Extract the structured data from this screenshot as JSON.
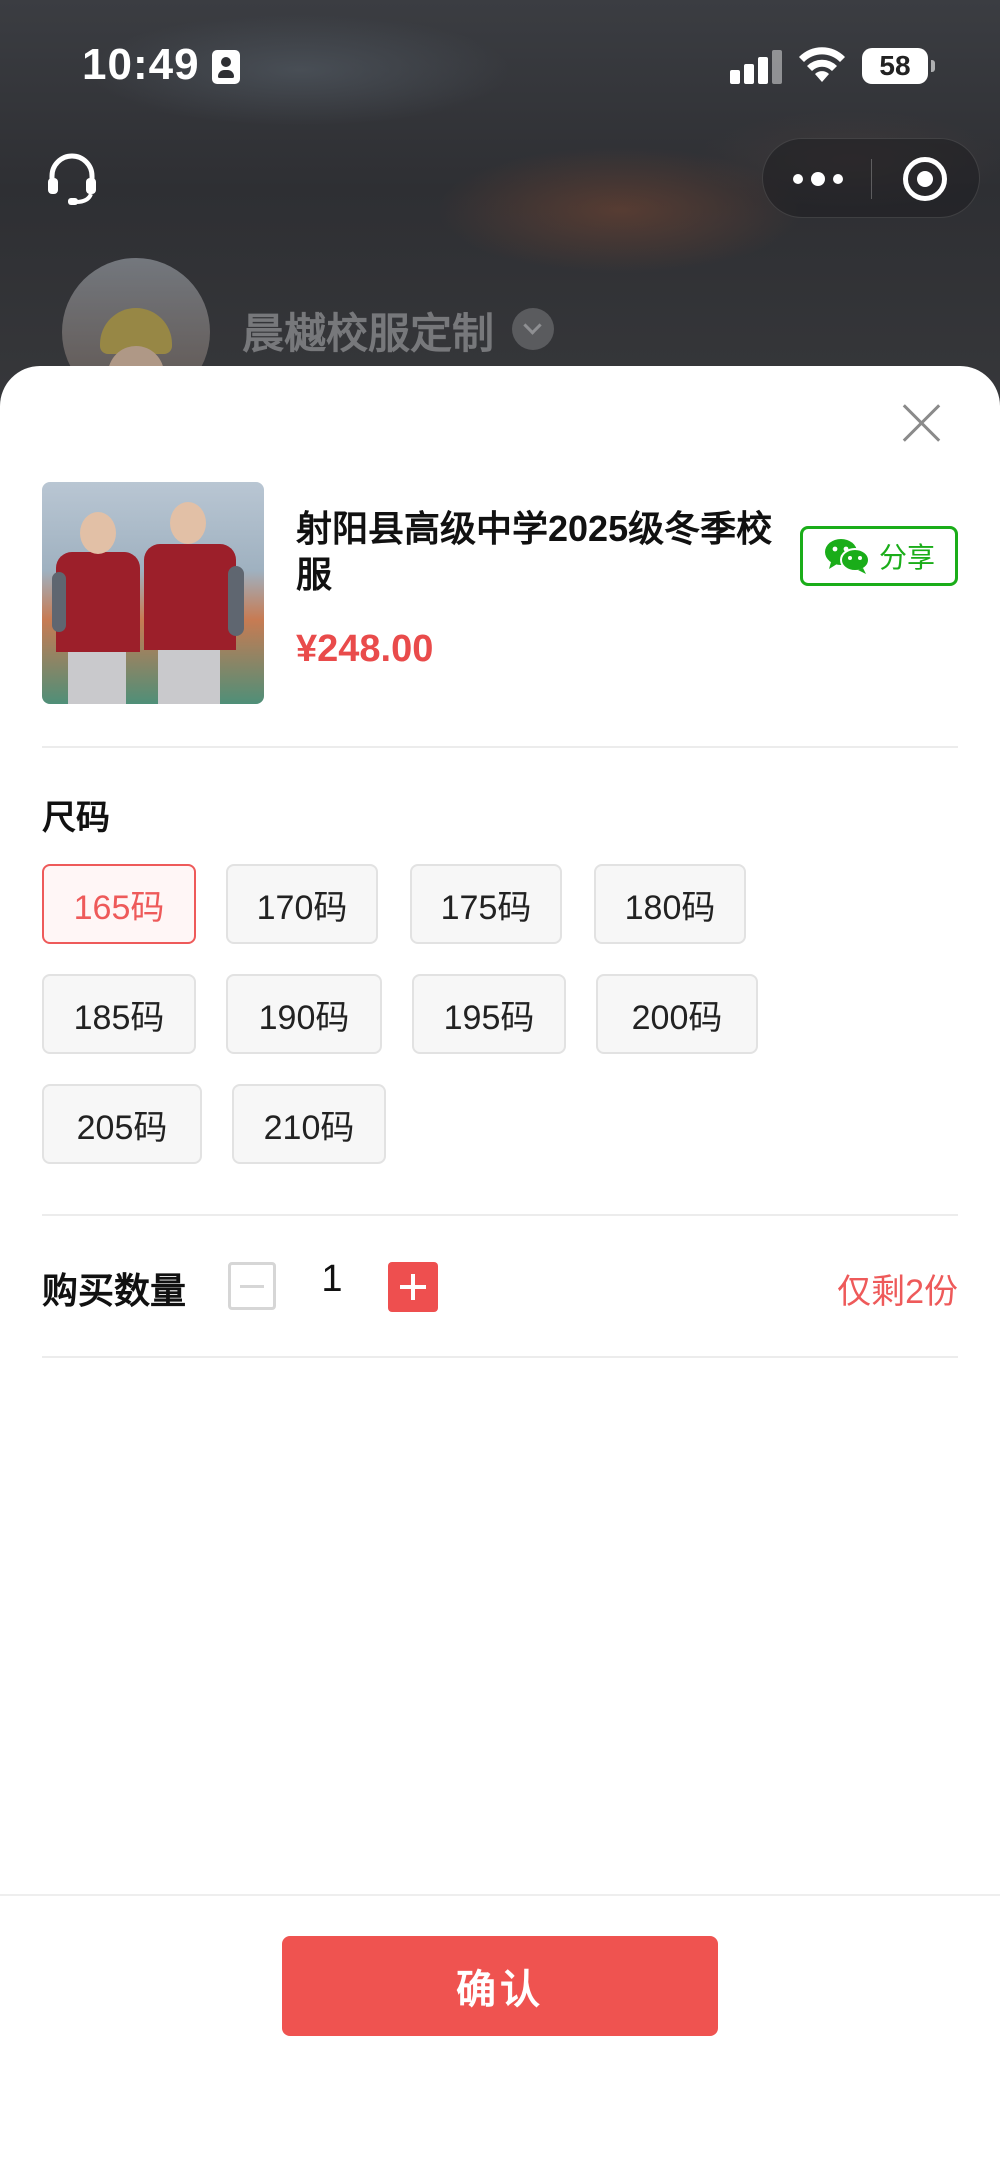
{
  "status_bar": {
    "time": "10:49",
    "battery": "58",
    "icons": [
      "id-card-icon",
      "signal-icon",
      "wifi-icon",
      "battery-icon"
    ]
  },
  "header": {
    "left_icon": "headset-icon",
    "capsule_icons": [
      "more-dots-icon",
      "capsule-close-icon"
    ],
    "shop_name": "晨樾校服定制"
  },
  "sheet": {
    "product": {
      "title": "射阳县高级中学2025级冬季校服",
      "price": "¥248.00"
    },
    "share": {
      "label": "分享",
      "icon": "wechat-icon",
      "color": "#1aad19"
    },
    "size": {
      "title": "尺码",
      "options": [
        "165码",
        "170码",
        "175码",
        "180码",
        "185码",
        "190码",
        "195码",
        "200码",
        "205码",
        "210码"
      ],
      "selected": "165码"
    },
    "quantity": {
      "label": "购买数量",
      "value": "1",
      "stock_note": "仅剩2份"
    },
    "confirm_label": "确认"
  },
  "colors": {
    "accent": "#ef5350",
    "price": "#e94b4b",
    "wechat_green": "#1aad19"
  }
}
